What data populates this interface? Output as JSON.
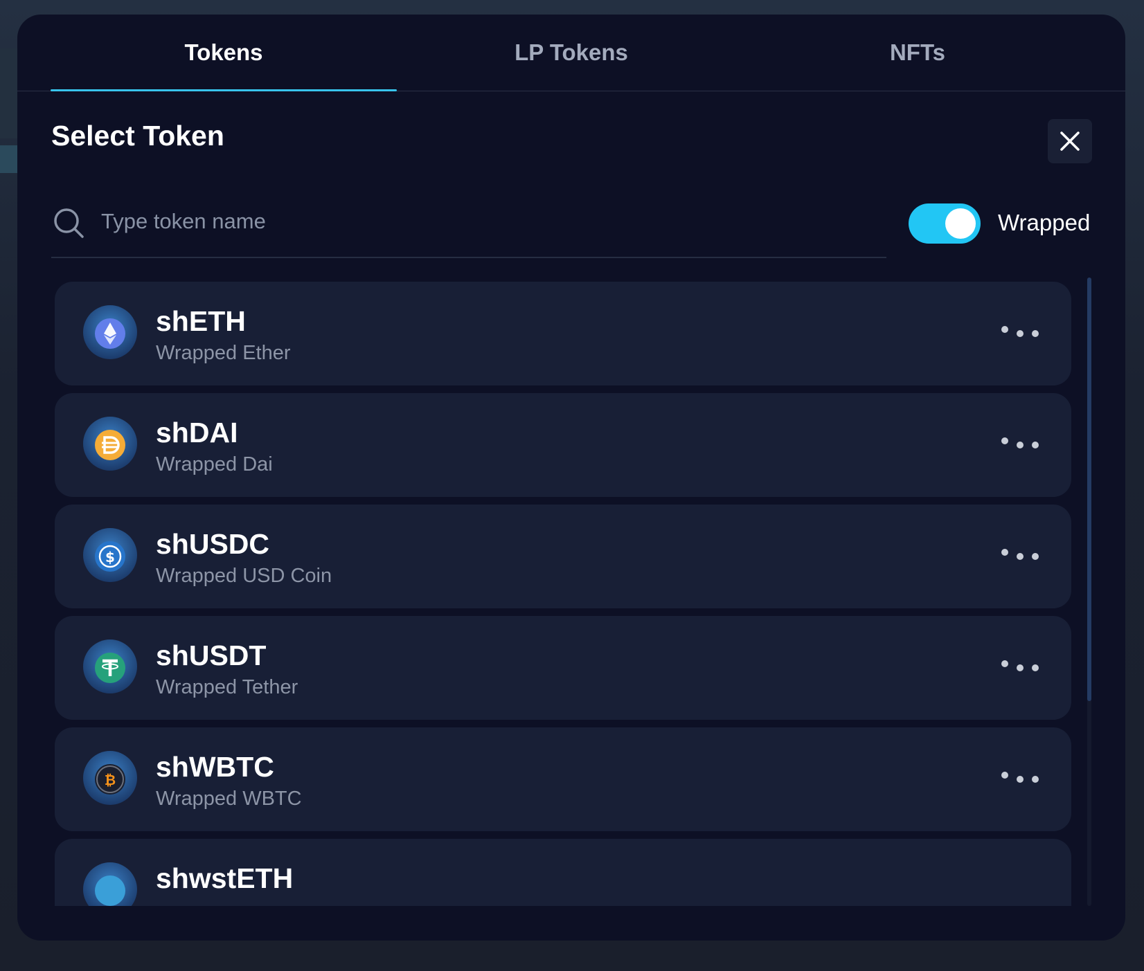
{
  "tabs": [
    {
      "label": "Tokens",
      "active": true
    },
    {
      "label": "LP Tokens",
      "active": false
    },
    {
      "label": "NFTs",
      "active": false
    }
  ],
  "title": "Select Token",
  "close_icon": "close-icon",
  "search": {
    "placeholder": "Type token name",
    "value": "",
    "icon": "search-icon"
  },
  "wrapped_toggle": {
    "label": "Wrapped",
    "on": true,
    "color": "#22c6f4"
  },
  "tokens": [
    {
      "symbol": "shETH",
      "name": "Wrapped Ether",
      "icon": "ethereum-icon",
      "color": "#627eea"
    },
    {
      "symbol": "shDAI",
      "name": "Wrapped Dai",
      "icon": "dai-icon",
      "color": "#f5ac37"
    },
    {
      "symbol": "shUSDC",
      "name": "Wrapped USD Coin",
      "icon": "usdc-icon",
      "color": "#2775ca"
    },
    {
      "symbol": "shUSDT",
      "name": "Wrapped Tether",
      "icon": "tether-icon",
      "color": "#26a17b"
    },
    {
      "symbol": "shWBTC",
      "name": "Wrapped WBTC",
      "icon": "bitcoin-icon",
      "color": "#f7931a"
    },
    {
      "symbol": "shwstETH",
      "name": "",
      "icon": "wsteth-icon",
      "color": "#3a9fd8"
    }
  ],
  "colors": {
    "modal_bg": "#0d1025",
    "row_bg": "#181f36",
    "accent": "#38c4ec"
  }
}
